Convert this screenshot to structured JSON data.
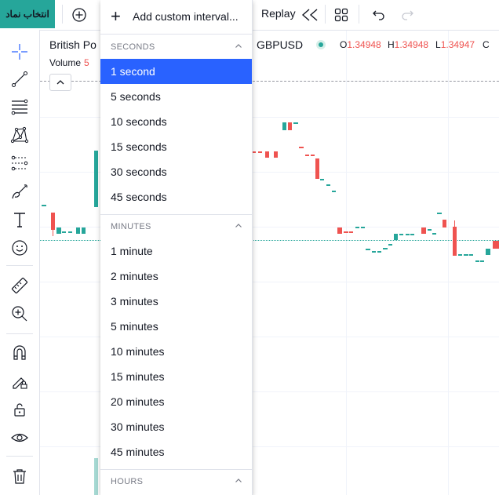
{
  "topbar": {
    "symbol_search_label": "انتخاب نماد",
    "replay_label": "Replay"
  },
  "legend": {
    "symbol_name": "British Po",
    "ticker": "GBPUSD",
    "open_label": "O",
    "open_value": "1.34948",
    "high_label": "H",
    "high_value": "1.34948",
    "low_label": "L",
    "low_value": "1.34947",
    "close_label": "C",
    "volume_label": "Volume",
    "volume_value": "5"
  },
  "interval_menu": {
    "add_custom_label": "Add custom interval...",
    "sections": [
      {
        "title": "SECONDS",
        "items": [
          "1 second",
          "5 seconds",
          "10 seconds",
          "15 seconds",
          "30 seconds",
          "45 seconds"
        ]
      },
      {
        "title": "MINUTES",
        "items": [
          "1 minute",
          "2 minutes",
          "3 minutes",
          "5 minutes",
          "10 minutes",
          "15 minutes",
          "20 minutes",
          "30 minutes",
          "45 minutes"
        ]
      },
      {
        "title": "HOURS",
        "items": []
      }
    ],
    "selected": "1 second"
  },
  "colors": {
    "up": "#26a69a",
    "down": "#ef5350",
    "accent": "#2962ff"
  }
}
